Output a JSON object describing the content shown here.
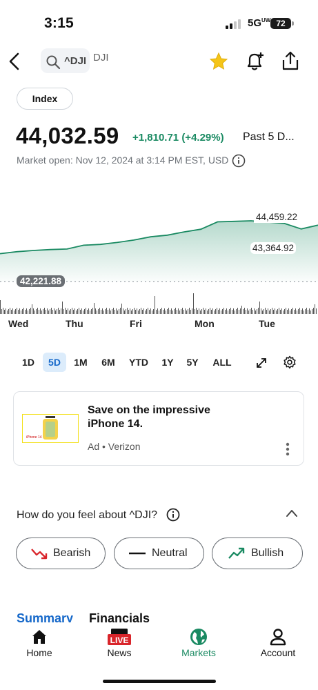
{
  "status_bar": {
    "time": "3:15",
    "network": "5G",
    "network_sup": "UW",
    "battery": "72"
  },
  "header": {
    "search_text": "^DJI",
    "name": "DJI",
    "starred": true
  },
  "quote": {
    "type_pill": "Index",
    "price": "44,032.59",
    "change": "+1,810.71 (+4.29%)",
    "period": "Past 5 D...",
    "market_status": "Market open: Nov 12, 2024 at 3:14 PM EST, USD"
  },
  "chart_data": {
    "type": "area",
    "period": "5D",
    "x": [
      "Wed",
      "Wed",
      "Wed",
      "Wed",
      "Thu",
      "Thu",
      "Thu",
      "Thu",
      "Fri",
      "Fri",
      "Fri",
      "Fri",
      "Mon",
      "Mon",
      "Mon",
      "Mon",
      "Tue",
      "Tue",
      "Tue",
      "Tue"
    ],
    "values": [
      43250,
      43320,
      43365,
      43400,
      43420,
      43560,
      43590,
      43660,
      43750,
      43870,
      43930,
      44050,
      44150,
      44420,
      44440,
      44459,
      44410,
      44360,
      44160,
      44300
    ],
    "high_label": "44,459.22",
    "previous_close_label": "43,364.92",
    "low_label": "42,221.88",
    "day_labels": [
      "Wed",
      "Thu",
      "Fri",
      "Mon",
      "Tue"
    ],
    "ylim": [
      42221.88,
      44459.22
    ],
    "color": "#1a8a62"
  },
  "ranges": [
    "1D",
    "5D",
    "1M",
    "6M",
    "YTD",
    "1Y",
    "5Y",
    "ALL"
  ],
  "selected_range": "5D",
  "ad": {
    "title": "Save on the impressive iPhone 14.",
    "sponsor": "Ad • Verizon",
    "image_label": "iPhone 14"
  },
  "sentiment": {
    "question": "How do you feel about ^DJI?",
    "bearish": "Bearish",
    "neutral": "Neutral",
    "bullish": "Bullish"
  },
  "tabs": {
    "summary": "Summary",
    "financials": "Financials"
  },
  "nav": {
    "home": "Home",
    "news": "News",
    "news_badge": "LIVE",
    "markets": "Markets",
    "account": "Account",
    "active": "Markets"
  },
  "colors": {
    "accent": "#1467c9",
    "up": "#1a8a62",
    "down": "#d9252b"
  }
}
